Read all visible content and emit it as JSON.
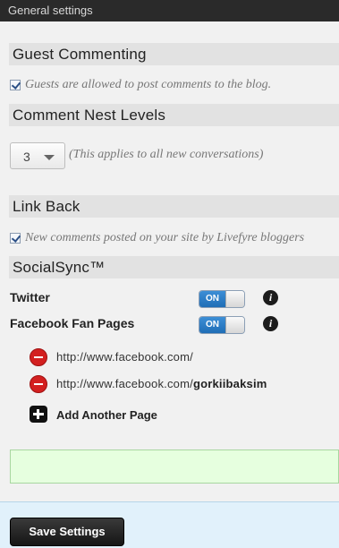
{
  "window": {
    "title": "General settings"
  },
  "guest_commenting": {
    "heading": "Guest Commenting",
    "checkbox_label": "Guests are allowed to post comments to the blog.",
    "checked": true
  },
  "nest_levels": {
    "heading": "Comment Nest Levels",
    "selected_value": "3",
    "note": "(This applies to all new conversations)"
  },
  "link_back": {
    "heading": "Link Back",
    "checkbox_label": "New comments posted on your site by Livefyre bloggers",
    "checked": true
  },
  "social_sync": {
    "heading": "SocialSync™",
    "services": [
      {
        "label": "Twitter",
        "toggle": "ON",
        "enabled": true
      },
      {
        "label": "Facebook Fan Pages",
        "toggle": "ON",
        "enabled": true
      }
    ],
    "pages": [
      {
        "url": "http://www.facebook.com/",
        "page": ""
      },
      {
        "url": "http://www.facebook.com/",
        "page": "gorkiibaksim"
      }
    ],
    "add_label": "Add Another Page"
  },
  "colors": {
    "section_bg": "#e2e2e2",
    "toggle_on": "#2a7cc7",
    "remove_red": "#d32020",
    "message_bg": "#e6ffdf",
    "footer_bg": "#e1f1fb"
  },
  "icons": {
    "checkbox": "checkbox-checked-icon",
    "dropdown": "chevron-down-icon",
    "info": "info-icon",
    "remove": "remove-circle-icon",
    "add": "plus-square-icon"
  },
  "footer": {
    "save_label": "Save Settings"
  }
}
